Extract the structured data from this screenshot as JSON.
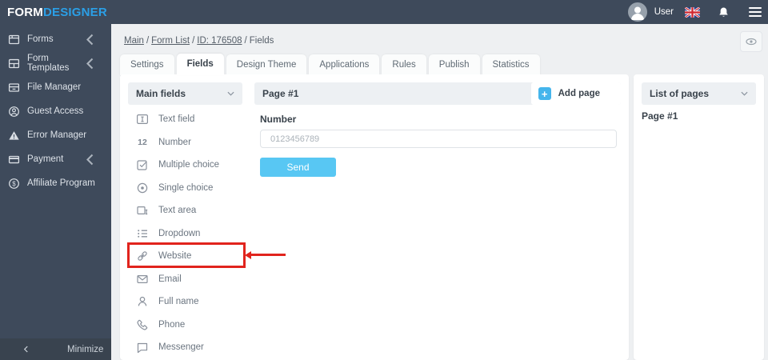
{
  "app": {
    "logo_primary": "FORM",
    "logo_secondary": "DESIGNER"
  },
  "topbar": {
    "user_label": "User",
    "icons": {
      "avatar": "person-circle",
      "language": "uk-flag",
      "notifications": "bell",
      "menu": "hamburger"
    }
  },
  "sidebar": {
    "items": [
      {
        "label": "Forms",
        "icon": "forms-icon",
        "has_submenu": true
      },
      {
        "label": "Form Templates",
        "icon": "form-templates-icon",
        "has_submenu": true
      },
      {
        "label": "File Manager",
        "icon": "file-manager-icon",
        "has_submenu": false
      },
      {
        "label": "Guest Access",
        "icon": "guest-access-icon",
        "has_submenu": false
      },
      {
        "label": "Error Manager",
        "icon": "error-manager-icon",
        "has_submenu": false
      },
      {
        "label": "Payment",
        "icon": "payment-icon",
        "has_submenu": true
      },
      {
        "label": "Affiliate Program",
        "icon": "affiliate-icon",
        "has_submenu": false
      }
    ],
    "minimize_label": "Minimize"
  },
  "breadcrumb": {
    "links": [
      "Main",
      "Form List",
      "ID: 176508"
    ],
    "current": "Fields",
    "separator": "/"
  },
  "tabs": {
    "items": [
      "Settings",
      "Fields",
      "Design Theme",
      "Applications",
      "Rules",
      "Publish",
      "Statistics"
    ],
    "active": "Fields"
  },
  "fields_panel": {
    "header": "Main fields",
    "items": [
      {
        "label": "Text field",
        "icon": "text-field-icon"
      },
      {
        "label": "Number",
        "icon": "number-icon",
        "icon_text": "12"
      },
      {
        "label": "Multiple choice",
        "icon": "multiple-choice-icon"
      },
      {
        "label": "Single choice",
        "icon": "single-choice-icon"
      },
      {
        "label": "Text area",
        "icon": "text-area-icon"
      },
      {
        "label": "Dropdown",
        "icon": "dropdown-icon"
      },
      {
        "label": "Website",
        "icon": "website-icon",
        "highlighted": true
      },
      {
        "label": "Email",
        "icon": "email-icon"
      },
      {
        "label": "Full name",
        "icon": "full-name-icon"
      },
      {
        "label": "Phone",
        "icon": "phone-icon"
      },
      {
        "label": "Messenger",
        "icon": "messenger-icon"
      }
    ]
  },
  "page_panel": {
    "header": "Page #1",
    "add_page_label": "Add page",
    "preview": {
      "field_label": "Number",
      "placeholder": "0123456789",
      "submit_label": "Send"
    }
  },
  "pages_panel": {
    "header": "List of pages",
    "pages": [
      "Page #1"
    ]
  },
  "annotation": {
    "type": "red-highlight-box-with-arrow",
    "target": "Website"
  },
  "colors": {
    "sidebar_dark": "#3e4a5b",
    "logo_blue": "#2b9fe6",
    "accent_blue": "#45b5ec",
    "button_blue": "#58c7f3",
    "annotation_red": "#e1241d",
    "bg_gray": "#eef0f2"
  }
}
